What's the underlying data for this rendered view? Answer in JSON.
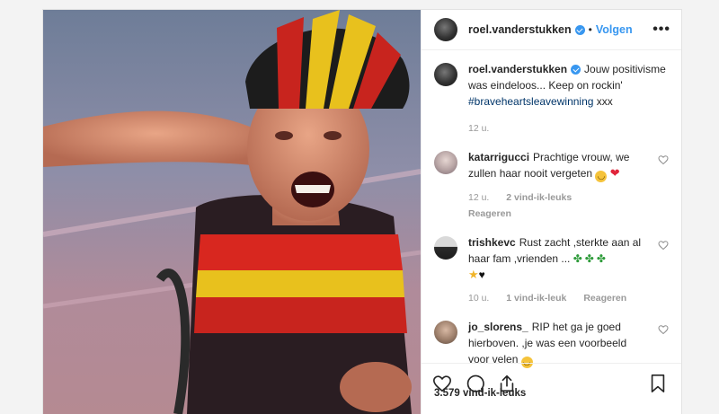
{
  "header": {
    "username": "roel.vanderstukken",
    "separator": "•",
    "follow_label": "Volgen",
    "more_label": "•••"
  },
  "caption": {
    "username": "roel.vanderstukken",
    "text": "Jouw positivisme was eindeloos... Keep on rockin'",
    "hashtag": "#braveheartsleavewinning",
    "suffix": "xxx",
    "time": "12 u."
  },
  "comments": [
    {
      "username": "katarrigucci",
      "text": "Prachtige vrouw, we zullen haar nooit vergeten",
      "time": "12 u.",
      "likes": "2 vind-ik-leuks",
      "reply": "Reageren",
      "emojis": [
        "smile",
        "red-heart"
      ]
    },
    {
      "username": "trishkevc",
      "text": "Rust zacht ,sterkte aan al haar fam ,vrienden ...",
      "time": "10 u.",
      "likes": "1 vind-ik-leuk",
      "reply": "Reageren",
      "emojis": [
        "four-leaf-clover",
        "four-leaf-clover",
        "four-leaf-clover",
        "star",
        "black-heart"
      ]
    },
    {
      "username": "jo_slorens_",
      "text": "RIP het ga je goed hierboven. ,je was een voorbeeld voor velen",
      "emojis": [
        "smile"
      ]
    }
  ],
  "footer": {
    "likes_count": "3.579 vind-ik-leuks"
  },
  "colors": {
    "accent": "#3897f0",
    "hashtag": "#003569",
    "muted": "#999999"
  }
}
